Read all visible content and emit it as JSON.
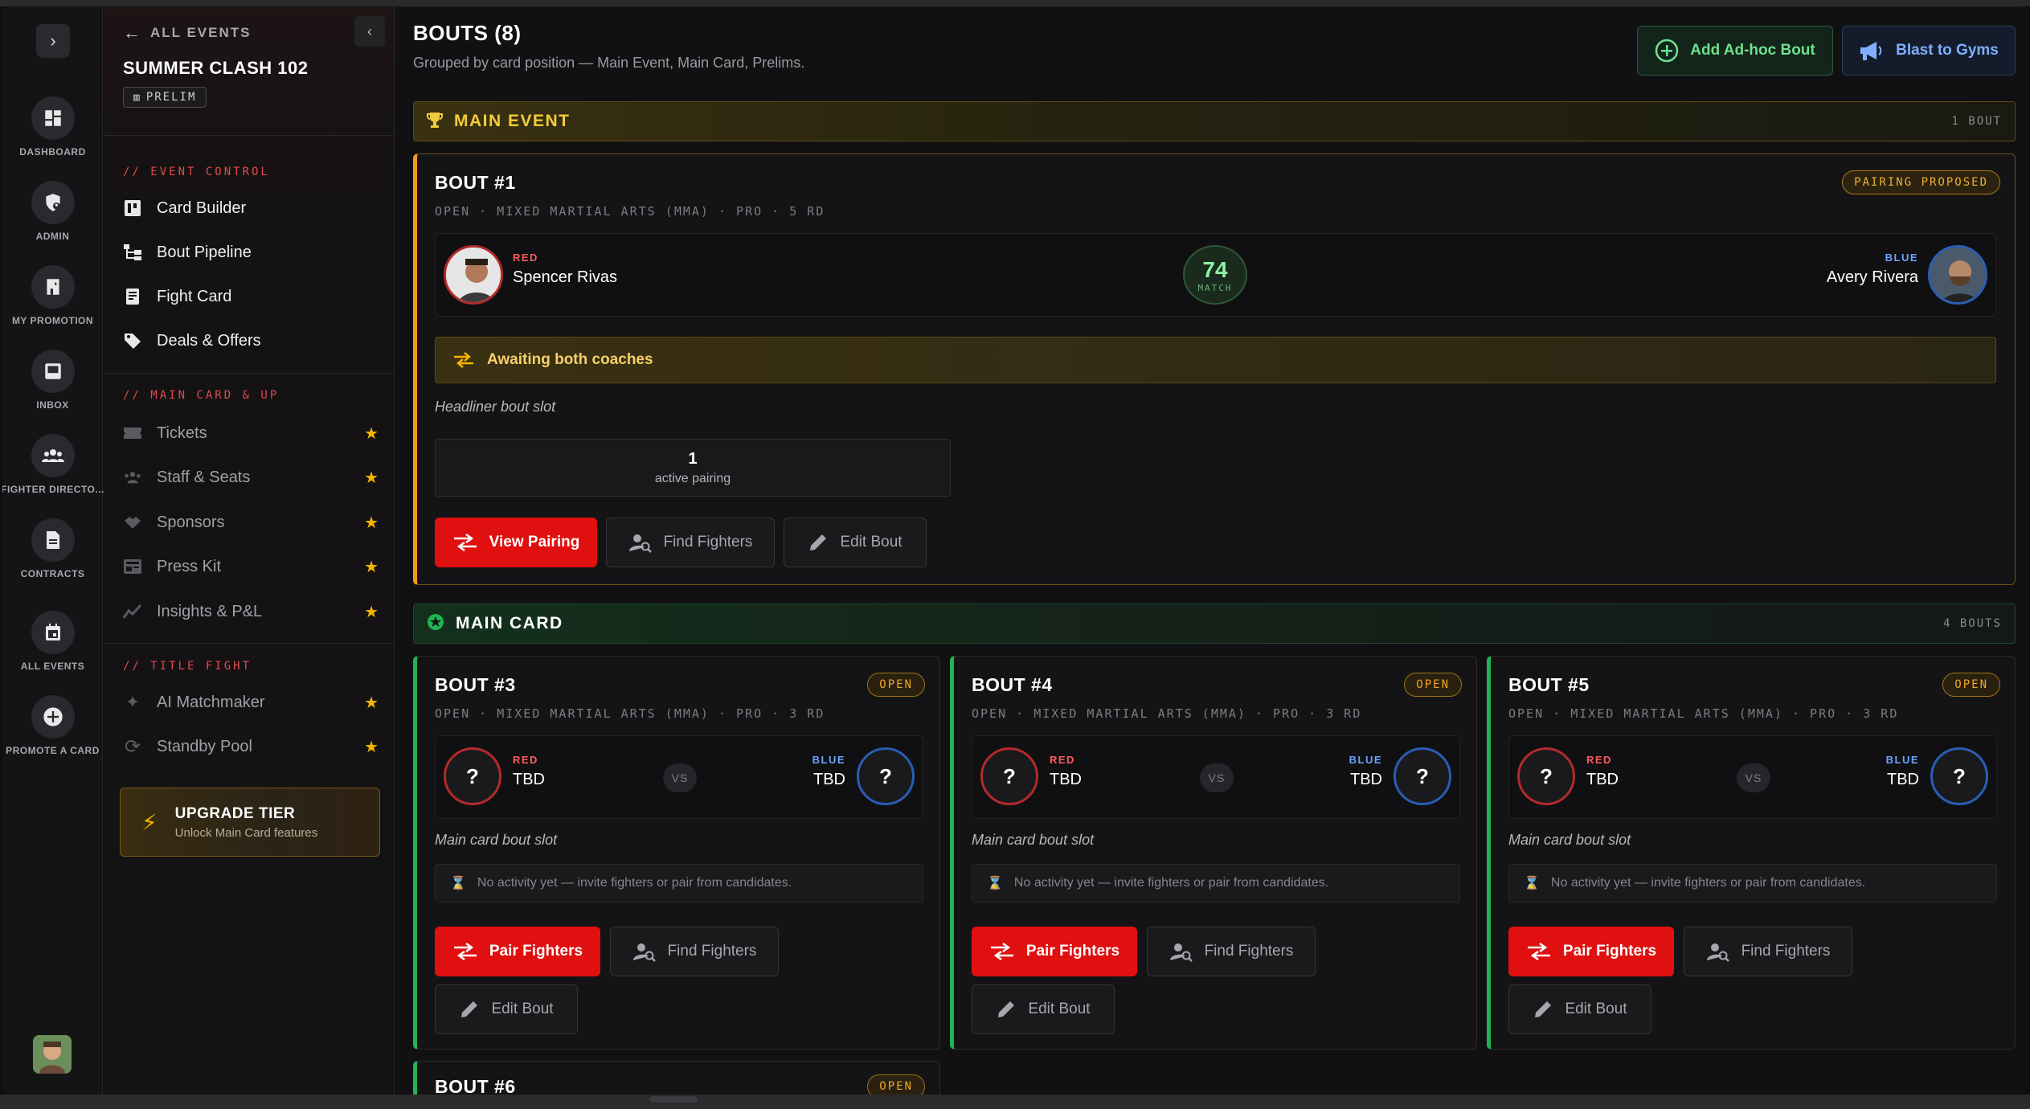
{
  "rail": {
    "toggle_glyph": "›",
    "items": [
      {
        "label": "DASHBOARD",
        "icon": "dashboard-icon"
      },
      {
        "label": "ADMIN",
        "icon": "shield-user-icon"
      },
      {
        "label": "MY PROMOTION",
        "icon": "building-icon"
      },
      {
        "label": "INBOX",
        "icon": "inbox-icon"
      },
      {
        "label": "FIGHTER DIRECTO...",
        "icon": "users-icon"
      },
      {
        "label": "CONTRACTS",
        "icon": "document-icon"
      },
      {
        "label": "ALL EVENTS",
        "icon": "calendar-icon"
      },
      {
        "label": "PROMOTE A CARD",
        "icon": "plus-circle-icon"
      }
    ]
  },
  "sidebar": {
    "back_label": "ALL EVENTS",
    "event_title": "SUMMER CLASH 102",
    "event_badge": "PRELIM",
    "sections": [
      {
        "title": "// EVENT CONTROL",
        "items": [
          {
            "label": "Card Builder",
            "locked": false
          },
          {
            "label": "Bout Pipeline",
            "locked": false
          },
          {
            "label": "Fight Card",
            "locked": false
          },
          {
            "label": "Deals & Offers",
            "locked": false
          }
        ]
      },
      {
        "title": "// MAIN CARD & UP",
        "items": [
          {
            "label": "Tickets",
            "locked": true
          },
          {
            "label": "Staff & Seats",
            "locked": true
          },
          {
            "label": "Sponsors",
            "locked": true
          },
          {
            "label": "Press Kit",
            "locked": true
          },
          {
            "label": "Insights & P&L",
            "locked": true
          }
        ]
      },
      {
        "title": "// TITLE FIGHT",
        "items": [
          {
            "label": "AI Matchmaker",
            "locked": true
          },
          {
            "label": "Standby Pool",
            "locked": true
          }
        ]
      }
    ],
    "upgrade": {
      "title": "UPGRADE TIER",
      "subtitle": "Unlock Main Card features"
    }
  },
  "main": {
    "title": "BOUTS (8)",
    "subtitle": "Grouped by card position — Main Event, Main Card, Prelims.",
    "add_adhoc_label": "Add Ad-hoc Bout",
    "blast_label": "Blast to Gyms",
    "groups": {
      "main_event": {
        "name": "MAIN EVENT",
        "count": "1 BOUT"
      },
      "main_card": {
        "name": "MAIN CARD",
        "count": "4 BOUTS"
      }
    },
    "main_event_bout": {
      "title": "BOUT #1",
      "status": "PAIRING PROPOSED",
      "meta": "OPEN · MIXED MARTIAL ARTS (MMA) · PRO · 5 RD",
      "red": {
        "corner": "RED",
        "name": "Spencer Rivas"
      },
      "blue": {
        "corner": "BLUE",
        "name": "Avery Rivera"
      },
      "match_score": "74",
      "match_label": "MATCH",
      "awaiting": "Awaiting both coaches",
      "note": "Headliner bout slot",
      "active_count": "1",
      "active_label": "active pairing",
      "btn_view": "View Pairing",
      "btn_find": "Find Fighters",
      "btn_edit": "Edit Bout"
    },
    "main_card_bouts": [
      {
        "title": "BOUT #3",
        "status": "OPEN",
        "meta": "OPEN · MIXED MARTIAL ARTS (MMA) · PRO · 3 RD",
        "red_corner": "RED",
        "red_name": "TBD",
        "blue_corner": "BLUE",
        "blue_name": "TBD",
        "vs": "VS",
        "unknown": "?",
        "note": "Main card bout slot",
        "activity": "No activity yet — invite fighters or pair from candidates.",
        "btn_pair": "Pair Fighters",
        "btn_find": "Find Fighters",
        "btn_edit": "Edit Bout"
      },
      {
        "title": "BOUT #4",
        "status": "OPEN",
        "meta": "OPEN · MIXED MARTIAL ARTS (MMA) · PRO · 3 RD",
        "red_corner": "RED",
        "red_name": "TBD",
        "blue_corner": "BLUE",
        "blue_name": "TBD",
        "vs": "VS",
        "unknown": "?",
        "note": "Main card bout slot",
        "activity": "No activity yet — invite fighters or pair from candidates.",
        "btn_pair": "Pair Fighters",
        "btn_find": "Find Fighters",
        "btn_edit": "Edit Bout"
      },
      {
        "title": "BOUT #5",
        "status": "OPEN",
        "meta": "OPEN · MIXED MARTIAL ARTS (MMA) · PRO · 3 RD",
        "red_corner": "RED",
        "red_name": "TBD",
        "blue_corner": "BLUE",
        "blue_name": "TBD",
        "vs": "VS",
        "unknown": "?",
        "note": "Main card bout slot",
        "activity": "No activity yet — invite fighters or pair from candidates.",
        "btn_pair": "Pair Fighters",
        "btn_find": "Find Fighters",
        "btn_edit": "Edit Bout"
      }
    ],
    "partial_bout": {
      "title": "BOUT #6",
      "status": "OPEN"
    }
  },
  "colors": {
    "accent_red": "#e01010",
    "gold": "#f2cc3c",
    "green": "#22b355",
    "blue": "#6aa4ff"
  }
}
